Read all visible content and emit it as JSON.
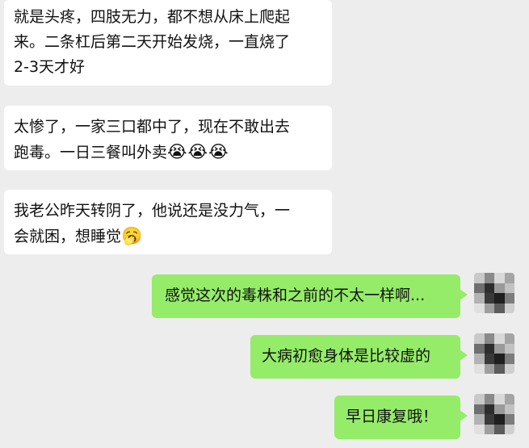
{
  "messages": [
    {
      "side": "in",
      "text": "就是头疼，四肢无力，都不想从床上爬起\n来。二条杠后第二天开始发烧，一直烧了\n2-3天才好",
      "emoji": ""
    },
    {
      "side": "in",
      "text": "太惨了，一家三口都中了，现在不敢出去\n跑毒。一日三餐叫外卖",
      "emoji": "😭😭😭"
    },
    {
      "side": "in",
      "text": "我老公昨天转阴了，他说还是没力气，一\n会就困，想睡觉",
      "emoji": "🥱"
    },
    {
      "side": "out",
      "text": "感觉这次的毒株和之前的不太一样啊...",
      "emoji": ""
    },
    {
      "side": "out",
      "text": "大病初愈身体是比较虚的",
      "emoji": ""
    },
    {
      "side": "out",
      "text": "早日康复哦！",
      "emoji": ""
    }
  ],
  "self_avatar": {
    "icon": "pixelated-avatar",
    "colors": [
      "#c9c9c9",
      "#8a8a8a",
      "#d8d8d8",
      "#a5a5a5",
      "#6f6f6f",
      "#2d2d2d",
      "#9a9a9a",
      "#c2c2c2",
      "#b3b3b3",
      "#3a3a3a",
      "#1f1f1f",
      "#7d7d7d",
      "#e0e0e0",
      "#9f9f9f",
      "#5c5c5c",
      "#cfcfcf"
    ]
  }
}
